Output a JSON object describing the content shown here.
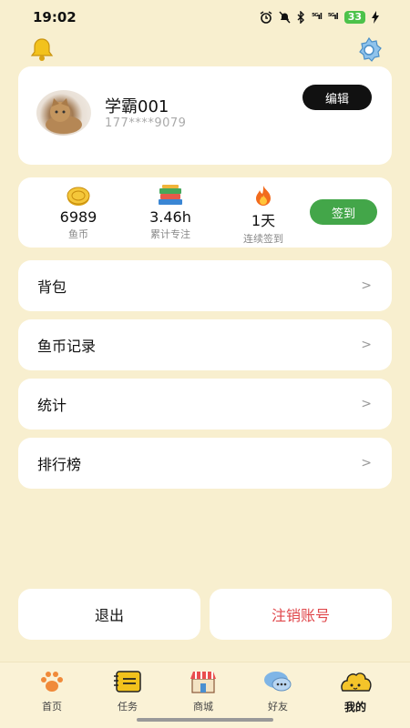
{
  "status": {
    "time": "19:02",
    "battery": "33"
  },
  "profile": {
    "name": "学霸001",
    "phone": "177****9079",
    "edit_label": "编辑"
  },
  "stats": {
    "coins_value": "6989",
    "coins_label": "鱼币",
    "focus_value": "3.46h",
    "focus_label": "累计专注",
    "streak_value": "1天",
    "streak_label": "连续签到",
    "checkin_label": "签到"
  },
  "menu": [
    {
      "label": "背包",
      "arrow": ">"
    },
    {
      "label": "鱼币记录",
      "arrow": ">"
    },
    {
      "label": "统计",
      "arrow": ">"
    },
    {
      "label": "排行榜",
      "arrow": ">"
    }
  ],
  "actions": {
    "logout": "退出",
    "delete_account": "注销账号"
  },
  "tabs": [
    {
      "label": "首页",
      "icon": "paw-icon"
    },
    {
      "label": "任务",
      "icon": "notebook-icon"
    },
    {
      "label": "商城",
      "icon": "shop-icon"
    },
    {
      "label": "好友",
      "icon": "chat-bubble-icon"
    },
    {
      "label": "我的",
      "icon": "blob-face-icon",
      "active": true
    }
  ],
  "colors": {
    "background": "#f8efcf",
    "accent_green": "#43a649",
    "danger_red": "#e0474b"
  }
}
